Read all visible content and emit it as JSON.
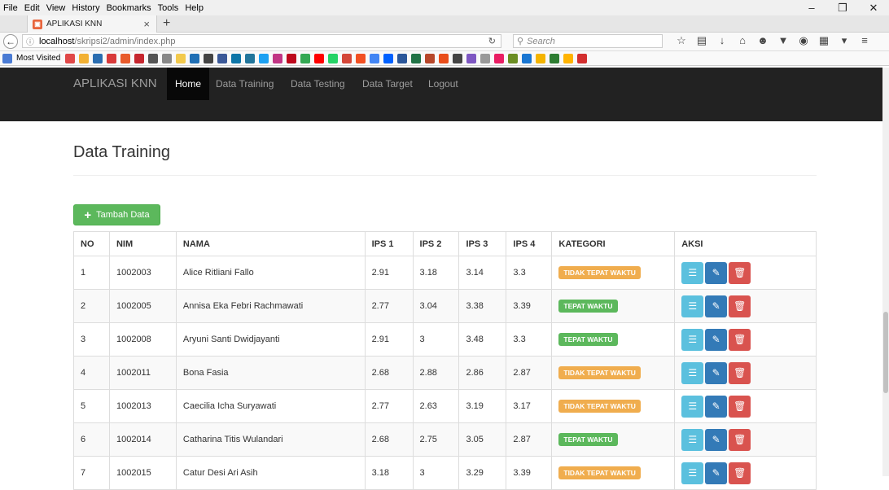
{
  "browser": {
    "menu": [
      "File",
      "Edit",
      "View",
      "History",
      "Bookmarks",
      "Tools",
      "Help"
    ],
    "tab_title": "APLIKASI KNN",
    "url_host": "localhost",
    "url_path": "/skripsi2/admin/index.php",
    "search_placeholder": "Search",
    "bookmarks_label": "Most Visited"
  },
  "app": {
    "brand": "APLIKASI KNN",
    "nav": [
      "Home",
      "Data Training",
      "Data Testing",
      "Data Target",
      "Logout"
    ],
    "active_nav": "Home"
  },
  "page": {
    "title": "Data Training",
    "add_button": "Tambah Data"
  },
  "table": {
    "headers": [
      "NO",
      "NIM",
      "NAMA",
      "IPS 1",
      "IPS 2",
      "IPS 3",
      "IPS 4",
      "KATEGORI",
      "AKSI"
    ],
    "rows": [
      {
        "no": "1",
        "nim": "1002003",
        "nama": "Alice Ritliani Fallo",
        "ips1": "2.91",
        "ips2": "3.18",
        "ips3": "3.14",
        "ips4": "3.3",
        "kategori": "TIDAK TEPAT WAKTU"
      },
      {
        "no": "2",
        "nim": "1002005",
        "nama": "Annisa Eka Febri Rachmawati",
        "ips1": "2.77",
        "ips2": "3.04",
        "ips3": "3.38",
        "ips4": "3.39",
        "kategori": "TEPAT WAKTU"
      },
      {
        "no": "3",
        "nim": "1002008",
        "nama": "Aryuni Santi Dwidjayanti",
        "ips1": "2.91",
        "ips2": "3",
        "ips3": "3.48",
        "ips4": "3.3",
        "kategori": "TEPAT WAKTU"
      },
      {
        "no": "4",
        "nim": "1002011",
        "nama": "Bona Fasia",
        "ips1": "2.68",
        "ips2": "2.88",
        "ips3": "2.86",
        "ips4": "2.87",
        "kategori": "TIDAK TEPAT WAKTU"
      },
      {
        "no": "5",
        "nim": "1002013",
        "nama": "Caecilia Icha Suryawati",
        "ips1": "2.77",
        "ips2": "2.63",
        "ips3": "3.19",
        "ips4": "3.17",
        "kategori": "TIDAK TEPAT WAKTU"
      },
      {
        "no": "6",
        "nim": "1002014",
        "nama": "Catharina Titis Wulandari",
        "ips1": "2.68",
        "ips2": "2.75",
        "ips3": "3.05",
        "ips4": "2.87",
        "kategori": "TEPAT WAKTU"
      },
      {
        "no": "7",
        "nim": "1002015",
        "nama": "Catur Desi Ari Asih",
        "ips1": "3.18",
        "ips2": "3",
        "ips3": "3.29",
        "ips4": "3.39",
        "kategori": "TIDAK TEPAT WAKTU"
      }
    ]
  },
  "colors": {
    "late_badge": "#f0ad4e",
    "ontime_badge": "#5cb85c",
    "navbar_bg": "#222222",
    "add_button": "#5cb85c"
  }
}
